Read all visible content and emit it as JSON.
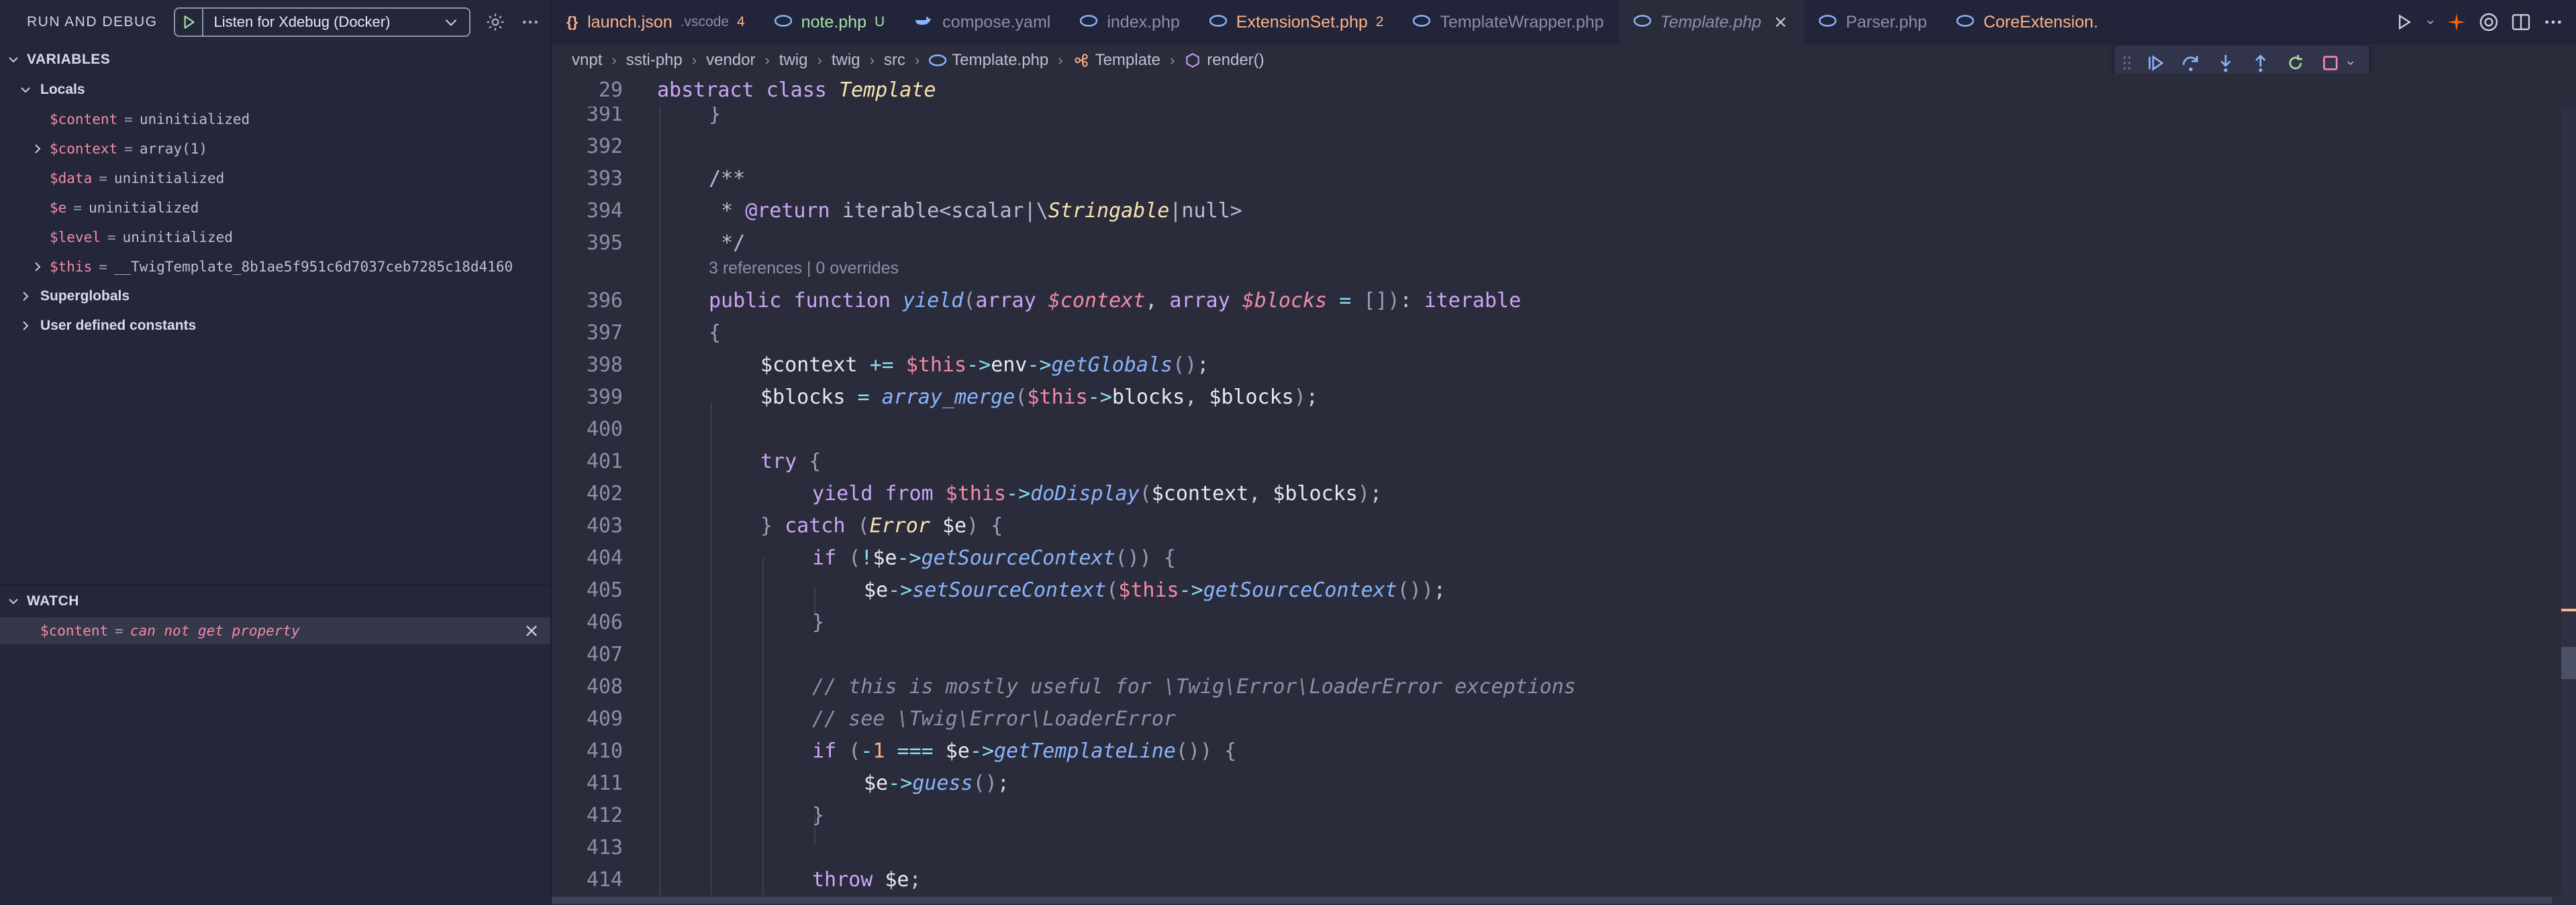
{
  "sidebar": {
    "title": "RUN AND DEBUG",
    "config_name": "Listen for Xdebug (Docker)",
    "variables_title": "VARIABLES",
    "locals_label": "Locals",
    "locals": [
      {
        "name": "$content",
        "value": "uninitialized",
        "expandable": false
      },
      {
        "name": "$context",
        "value": "array(1)",
        "expandable": true
      },
      {
        "name": "$data",
        "value": "uninitialized",
        "expandable": false
      },
      {
        "name": "$e",
        "value": "uninitialized",
        "expandable": false
      },
      {
        "name": "$level",
        "value": "uninitialized",
        "expandable": false
      },
      {
        "name": "$this",
        "value": "__TwigTemplate_8b1ae5f951c6d7037ceb7285c18d4160",
        "expandable": true
      }
    ],
    "superglobals_label": "Superglobals",
    "constants_label": "User defined constants",
    "watch_title": "WATCH",
    "watch": [
      {
        "name": "$content",
        "value": "can not get property"
      }
    ]
  },
  "tabs": [
    {
      "icon": "{}",
      "label": "launch.json",
      "desc": ".vscode",
      "badge": "4",
      "color": "#fab387",
      "badge_color": "#fab387"
    },
    {
      "icon": "php-icon",
      "label": "note.php",
      "desc": "",
      "badge": "U",
      "color": "#a6e3a1",
      "badge_color": "#a6e3a1"
    },
    {
      "icon": "docker-icon",
      "label": "compose.yaml",
      "desc": "",
      "badge": "",
      "color": "#8a90a4",
      "badge_color": ""
    },
    {
      "icon": "php-icon",
      "label": "index.php",
      "desc": "",
      "badge": "",
      "color": "#8a90a4",
      "badge_color": ""
    },
    {
      "icon": "php-icon",
      "label": "ExtensionSet.php",
      "desc": "",
      "badge": "2",
      "color": "#fab387",
      "badge_color": "#fab387"
    },
    {
      "icon": "php-icon",
      "label": "TemplateWrapper.php",
      "desc": "",
      "badge": "",
      "color": "#8a90a4",
      "badge_color": ""
    },
    {
      "icon": "php-icon",
      "label": "Template.php",
      "desc": "",
      "badge": "",
      "color": "#8a90a4",
      "badge_color": "",
      "active": true
    },
    {
      "icon": "php-icon",
      "label": "Parser.php",
      "desc": "",
      "badge": "",
      "color": "#8a90a4",
      "badge_color": ""
    },
    {
      "icon": "php-icon",
      "label": "CoreExtension.",
      "desc": "",
      "badge": "",
      "color": "#fab387",
      "badge_color": ""
    }
  ],
  "breadcrumb": [
    "vnpt",
    "ssti-php",
    "vendor",
    "twig",
    "twig",
    "src",
    "Template.php",
    "Template",
    "render()"
  ],
  "editor": {
    "sticky": {
      "number": "29",
      "code": "abstract class Template"
    },
    "codelens": "3 references | 0 overrides",
    "lines": [
      {
        "n": "391"
      },
      {
        "n": "392"
      },
      {
        "n": "393"
      },
      {
        "n": "394"
      },
      {
        "n": "395"
      },
      {
        "n": "396"
      },
      {
        "n": "397"
      },
      {
        "n": "398"
      },
      {
        "n": "399"
      },
      {
        "n": "400"
      },
      {
        "n": "401"
      },
      {
        "n": "402"
      },
      {
        "n": "403"
      },
      {
        "n": "404"
      },
      {
        "n": "405"
      },
      {
        "n": "406"
      },
      {
        "n": "407"
      },
      {
        "n": "408"
      },
      {
        "n": "409"
      },
      {
        "n": "410"
      },
      {
        "n": "411"
      },
      {
        "n": "412"
      },
      {
        "n": "413"
      },
      {
        "n": "414"
      }
    ]
  },
  "colors": {
    "accent": "#89b4fa",
    "variable_name": "#f38ba8",
    "modified": "#fab387",
    "untracked": "#a6e3a1"
  }
}
